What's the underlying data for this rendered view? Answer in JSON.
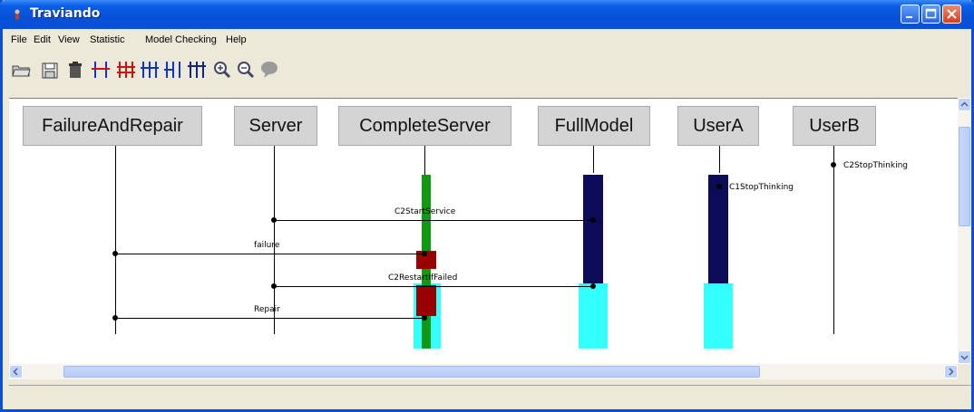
{
  "window": {
    "title": "Traviando"
  },
  "menu": [
    "File",
    "Edit",
    "View",
    "Statistic",
    "Model Checking",
    "Help"
  ],
  "toolbar": {
    "buttons": [
      "open-icon",
      "save-icon",
      "delete-icon",
      "merge-icon",
      "grid-red-icon",
      "grid-icon",
      "grid-left-icon",
      "grid-dark-icon",
      "zoom-in-icon",
      "zoom-out-icon",
      "comment-icon"
    ]
  },
  "diagram": {
    "objects": [
      "FailureAndRepair",
      "Server",
      "CompleteServer",
      "FullModel",
      "UserA",
      "UserB"
    ],
    "messages": {
      "c2_start_service": "C2StartService",
      "failure": "failure",
      "c2_restart_if_failed": "C2RestartIfFailed",
      "repair": "Repair",
      "c1_stop_thinking": "C1StopThinking",
      "c2_stop_thinking": "C2StopThinking"
    },
    "colors": {
      "green": "#119911",
      "navy": "#0b0b5a",
      "cyan": "#33ffff",
      "darkred": "#990000"
    }
  }
}
